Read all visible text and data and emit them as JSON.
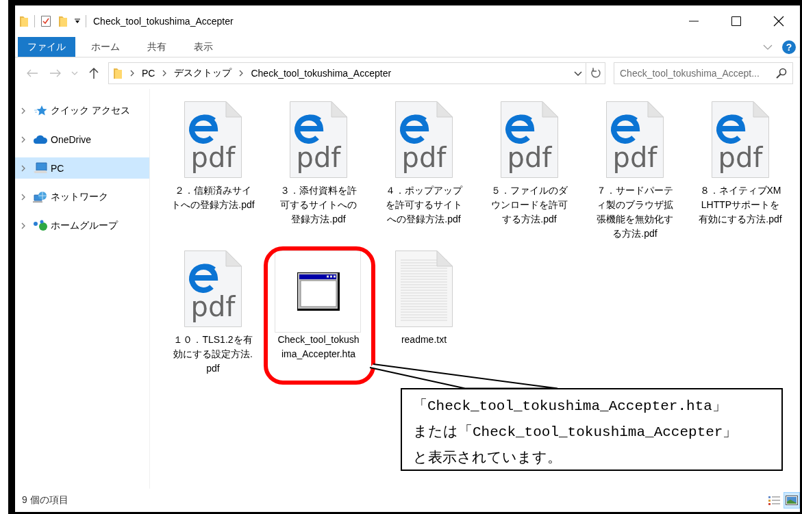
{
  "window": {
    "title": "Check_tool_tokushima_Accepter"
  },
  "ribbon": {
    "tabs": [
      {
        "label": "ファイル",
        "kind": "file",
        "selected": false
      },
      {
        "label": "ホーム",
        "kind": "tab",
        "selected": false
      },
      {
        "label": "共有",
        "kind": "tab",
        "selected": false
      },
      {
        "label": "表示",
        "kind": "tab",
        "selected": false
      }
    ],
    "help": "?"
  },
  "nav_buttons": [
    {
      "kind": "back",
      "disabled": true
    },
    {
      "kind": "forward",
      "disabled": true
    },
    {
      "kind": "recent",
      "disabled": true
    },
    {
      "kind": "up",
      "disabled": false
    }
  ],
  "address": {
    "crumbs": [
      "PC",
      "デスクトップ",
      "Check_tool_tokushima_Accepter"
    ]
  },
  "search": {
    "placeholder": "Check_tool_tokushima_Accept..."
  },
  "nav_pane": {
    "items": [
      {
        "label": "クイック アクセス",
        "kind": "quick",
        "selected": false,
        "expanded": false
      },
      {
        "label": "OneDrive",
        "kind": "cloud",
        "selected": false,
        "expanded": false
      },
      {
        "label": "PC",
        "kind": "pc",
        "selected": true,
        "expanded": false
      },
      {
        "label": "ネットワーク",
        "kind": "network",
        "selected": false,
        "expanded": false
      },
      {
        "label": "ホームグループ",
        "kind": "homegroup",
        "selected": false,
        "expanded": false
      }
    ]
  },
  "files": [
    {
      "name": "２．信頼済みサイトへの登録方法.pdf",
      "kind": "pdf",
      "icon_text": "pdf",
      "focused": false
    },
    {
      "name": "３．添付資料を許可するサイトへの登録方法.pdf",
      "kind": "pdf",
      "icon_text": "pdf",
      "focused": false
    },
    {
      "name": "４．ポップアップを許可するサイトへの登録方法.pdf",
      "kind": "pdf",
      "icon_text": "pdf",
      "focused": false
    },
    {
      "name": "５．ファイルのダウンロードを許可する方法.pdf",
      "kind": "pdf",
      "icon_text": "pdf",
      "focused": false
    },
    {
      "name": "７．サードパーティ製のブラウザ拡張機能を無効化する方法.pdf",
      "kind": "pdf",
      "icon_text": "pdf",
      "focused": false
    },
    {
      "name": "８．ネイティブXMLHTTPサポートを有効にする方法.pdf",
      "kind": "pdf",
      "icon_text": "pdf",
      "focused": false
    },
    {
      "name": "１０．TLS1.2を有効にする設定方法.pdf",
      "kind": "pdf",
      "icon_text": "pdf",
      "focused": false
    },
    {
      "name": "Check_tool_tokushima_Accepter.hta",
      "kind": "hta",
      "focused": true
    },
    {
      "name": "readme.txt",
      "kind": "txt",
      "focused": false
    }
  ],
  "status_bar": {
    "count": "9 個の項目",
    "views": [
      {
        "kind": "details",
        "selected": false
      },
      {
        "kind": "large_icons",
        "selected": true
      }
    ]
  },
  "callout": {
    "lines": [
      "「Check_tool_tokushima_Accepter.hta」",
      "または「Check_tool_tokushima_Accepter」",
      "と表示されています。"
    ]
  }
}
